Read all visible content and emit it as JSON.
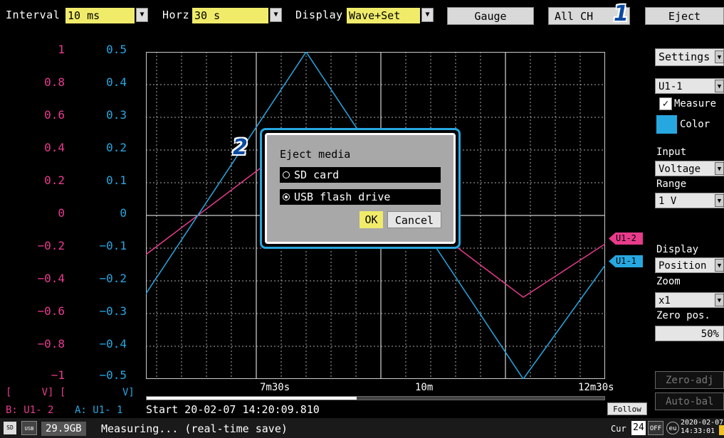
{
  "toolbar": {
    "interval_label": "Interval",
    "interval_value": "10 ms",
    "horz_label": "Horz",
    "horz_value": "30 s",
    "display_label": "Display",
    "display_value": "Wave+Set",
    "gauge_label": "Gauge",
    "allch_label": "All CH",
    "eject_label": "Eject"
  },
  "steps": {
    "one": "1",
    "two": "2"
  },
  "graph": {
    "y_axis_b": [
      "1",
      "0.8",
      "0.6",
      "0.4",
      "0.2",
      "0",
      "−0.2",
      "−0.4",
      "−0.6",
      "−0.8",
      "−1"
    ],
    "y_axis_a": [
      "0.5",
      "0.4",
      "0.3",
      "0.2",
      "0.1",
      "0",
      "−0.1",
      "−0.2",
      "−0.3",
      "−0.4",
      "−0.5"
    ],
    "x_ticks": [
      "7m30s",
      "10m",
      "12m30s"
    ],
    "unit_b": "[     V] [",
    "unit_a": "V]",
    "ch_b": "B:  U1- 2",
    "ch_a": "A:  U1- 1",
    "start_text": "Start 20-02-07 14:20:09.810",
    "follow_label": "Follow",
    "markers": {
      "u12": "U1-2",
      "u11": "U1-1"
    },
    "colors": {
      "u11": "#27a7e0",
      "u12": "#e83b8c"
    }
  },
  "dialog": {
    "title": "Eject media",
    "option_sd": "SD card",
    "option_usb": "USB flash drive",
    "selected": "USB flash drive",
    "ok_label": "OK",
    "cancel_label": "Cancel"
  },
  "panel": {
    "settings": "Settings",
    "channel": "U1-1",
    "measure": "Measure",
    "color": "Color",
    "input_label": "Input",
    "input_value": "Voltage",
    "range_label": "Range",
    "range_value": "1 V",
    "display_label": "Display",
    "display_value": "Position",
    "zoom_label": "Zoom",
    "zoom_value": "x1",
    "zero_label": "Zero pos.",
    "zero_value": "50%",
    "zero_adj": "Zero-adj",
    "auto_bal": "Auto-bal"
  },
  "status": {
    "free_space": "29.9GB",
    "message": "Measuring... (real-time save)",
    "cur_label": "Cur",
    "num24": "24",
    "off": "OFF",
    "eu": "eu",
    "date": "2020-02-07",
    "time": "14:33:01"
  }
}
